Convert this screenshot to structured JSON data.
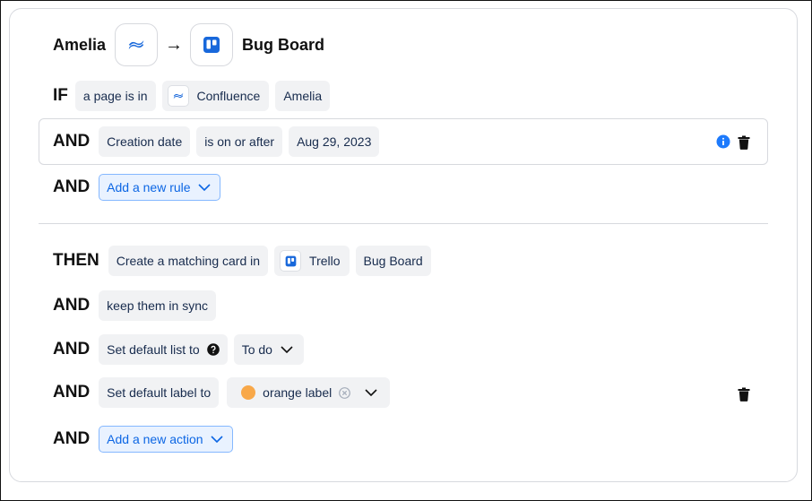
{
  "header": {
    "source_name": "Amelia",
    "source_app_icon": "confluence-icon",
    "arrow": "→",
    "target_app_icon": "trello-icon",
    "target_name": "Bug Board"
  },
  "trigger": {
    "keyword": "IF",
    "condition": "a page is in",
    "app_label": "Confluence",
    "space": "Amelia"
  },
  "rule": {
    "keyword": "AND",
    "field": "Creation date",
    "operator": "is on or after",
    "value": "Aug 29, 2023"
  },
  "add_rule": {
    "keyword": "AND",
    "label": "Add a new rule"
  },
  "action": {
    "keyword": "THEN",
    "text": "Create a matching card in",
    "app_label": "Trello",
    "board": "Bug Board"
  },
  "sync": {
    "keyword": "AND",
    "text": "keep them in sync"
  },
  "default_list": {
    "keyword": "AND",
    "text": "Set default list to",
    "selected": "To do"
  },
  "default_label": {
    "keyword": "AND",
    "text": "Set default label to",
    "selected": "orange label",
    "label_color": "#f8a849"
  },
  "add_action": {
    "keyword": "AND",
    "label": "Add a new action"
  },
  "colors": {
    "confluence_blue": "#1868db",
    "trello_blue": "#1868db",
    "link_blue": "#0c66e4",
    "info_blue": "#1d7afc"
  }
}
